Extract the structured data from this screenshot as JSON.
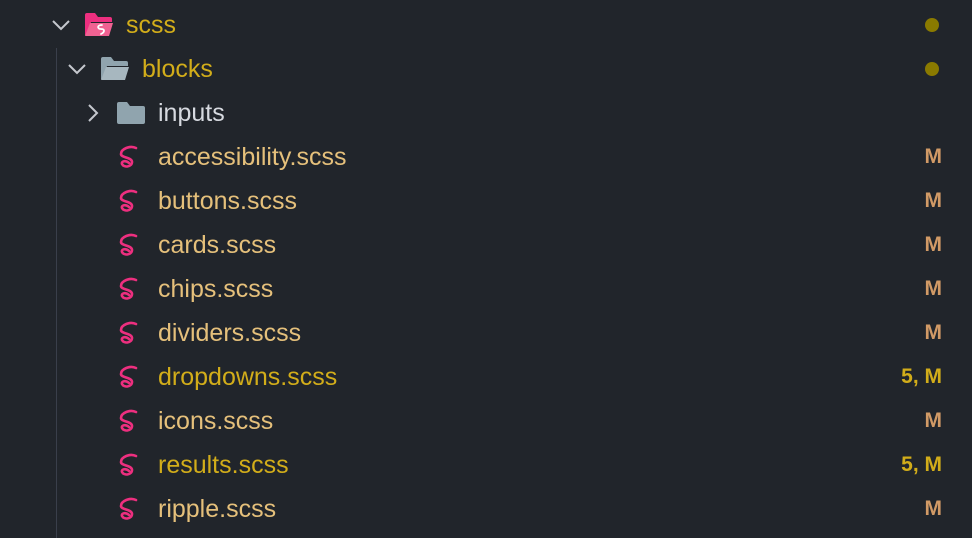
{
  "colors": {
    "background": "#21252b",
    "folder_text": "#d2ad1a",
    "folder_plain_text": "#d7dae0",
    "modified_text": "#e5c07b",
    "warning_text": "#d2ad1a",
    "modified_badge": "#d19a66",
    "warning_badge": "#d2ad1a",
    "sass_icon": "#ed2f7f",
    "folder_icon": "#90a4ae",
    "dot": "#8a7a00"
  },
  "tree": {
    "root": {
      "name": "scss",
      "expanded": true,
      "icon": "sass-folder-open-icon",
      "has_changes_dot": true
    },
    "blocks": {
      "name": "blocks",
      "expanded": true,
      "icon": "folder-open-icon",
      "has_changes_dot": true
    },
    "inputs": {
      "name": "inputs",
      "expanded": false,
      "icon": "folder-icon"
    },
    "files": [
      {
        "name": "accessibility.scss",
        "badge": "M",
        "state": "modified",
        "icon": "sass-file-icon"
      },
      {
        "name": "buttons.scss",
        "badge": "M",
        "state": "modified",
        "icon": "sass-file-icon"
      },
      {
        "name": "cards.scss",
        "badge": "M",
        "state": "modified",
        "icon": "sass-file-icon"
      },
      {
        "name": "chips.scss",
        "badge": "M",
        "state": "modified",
        "icon": "sass-file-icon"
      },
      {
        "name": "dividers.scss",
        "badge": "M",
        "state": "modified",
        "icon": "sass-file-icon"
      },
      {
        "name": "dropdowns.scss",
        "badge": "5, M",
        "state": "warning",
        "icon": "sass-file-icon"
      },
      {
        "name": "icons.scss",
        "badge": "M",
        "state": "modified",
        "icon": "sass-file-icon"
      },
      {
        "name": "results.scss",
        "badge": "5, M",
        "state": "warning",
        "icon": "sass-file-icon"
      },
      {
        "name": "ripple.scss",
        "badge": "M",
        "state": "modified",
        "icon": "sass-file-icon"
      }
    ]
  }
}
